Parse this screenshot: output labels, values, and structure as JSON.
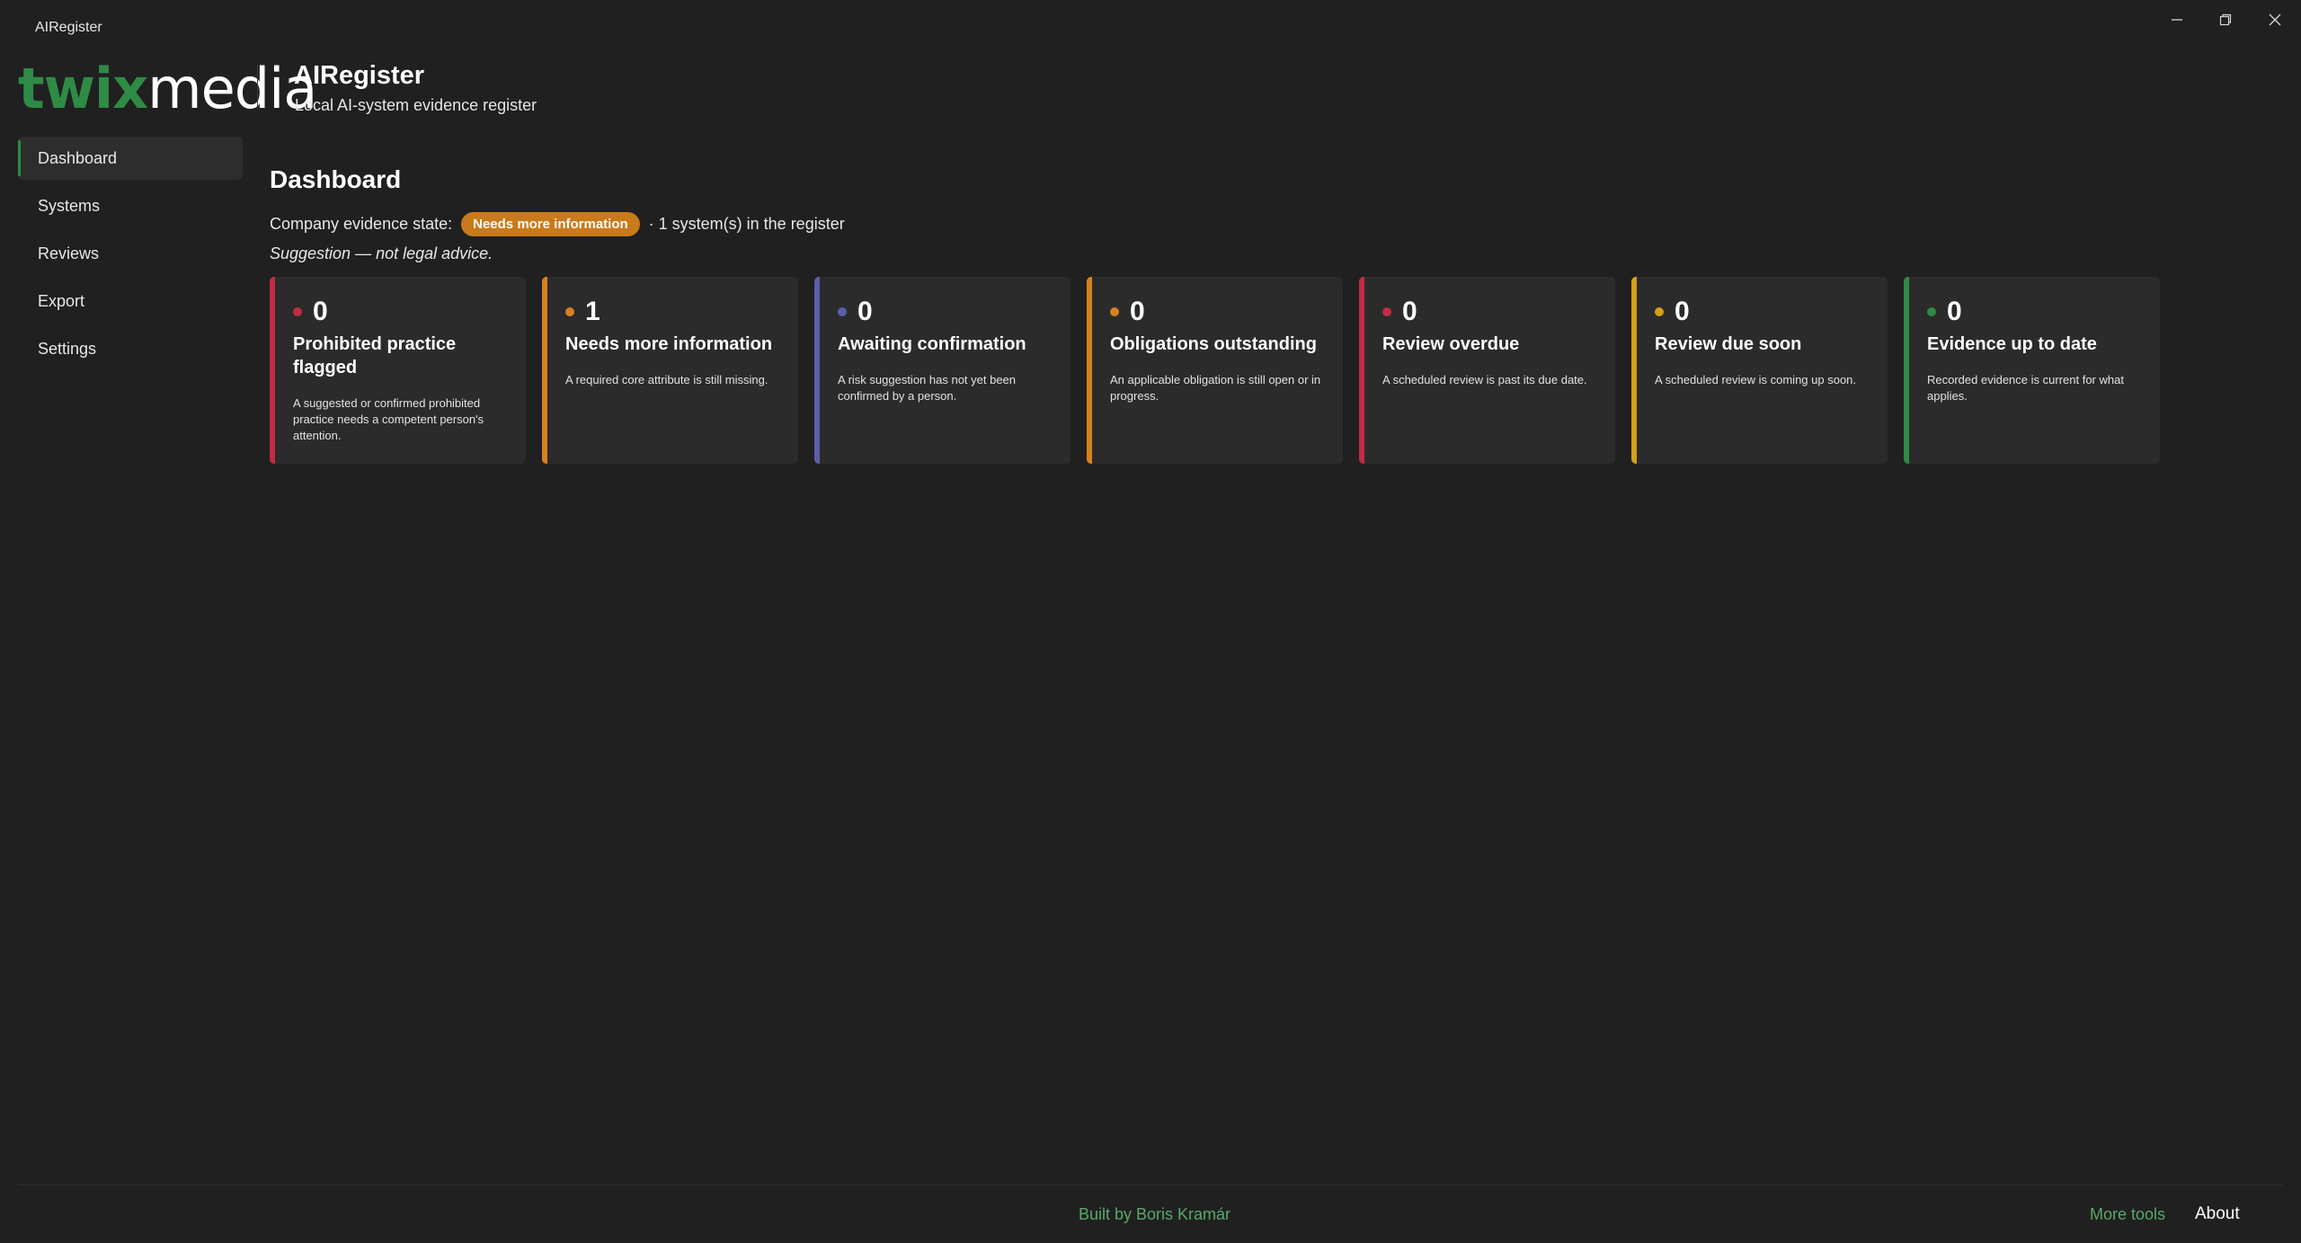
{
  "window": {
    "title": "AIRegister"
  },
  "brand": {
    "logo_part1": "twix",
    "logo_part2": "media",
    "title": "AIRegister",
    "subtitle": "Local AI-system evidence register"
  },
  "nav": {
    "items": [
      {
        "label": "Dashboard",
        "active": true
      },
      {
        "label": "Systems"
      },
      {
        "label": "Reviews"
      },
      {
        "label": "Export"
      },
      {
        "label": "Settings"
      }
    ]
  },
  "dashboard": {
    "title": "Dashboard",
    "state_label": "Company evidence state:",
    "state_badge": "Needs more information",
    "system_count_text": "· 1 system(s) in the register",
    "disclaimer": "Suggestion — not legal advice."
  },
  "cards": [
    {
      "count": "0",
      "label": "Prohibited practice flagged",
      "desc": "A suggested or confirmed prohibited practice needs a competent person's attention.",
      "color": "#c42a45"
    },
    {
      "count": "1",
      "label": "Needs more information",
      "desc": "A required core attribute is still missing.",
      "color": "#d9801f"
    },
    {
      "count": "0",
      "label": "Awaiting confirmation",
      "desc": "A risk suggestion has not yet been confirmed by a person.",
      "color": "#5b5fa8"
    },
    {
      "count": "0",
      "label": "Obligations outstanding",
      "desc": "An applicable obligation is still open or in progress.",
      "color": "#d9801f"
    },
    {
      "count": "0",
      "label": "Review overdue",
      "desc": "A scheduled review is past its due date.",
      "color": "#c42a45"
    },
    {
      "count": "0",
      "label": "Review due soon",
      "desc": "A scheduled review is coming up soon.",
      "color": "#d4a017"
    },
    {
      "count": "0",
      "label": "Evidence up to date",
      "desc": "Recorded evidence is current for what applies.",
      "color": "#2e8b45"
    }
  ],
  "footer": {
    "built_by": "Built by Boris Kramár",
    "more_tools": "More tools",
    "about": "About"
  }
}
